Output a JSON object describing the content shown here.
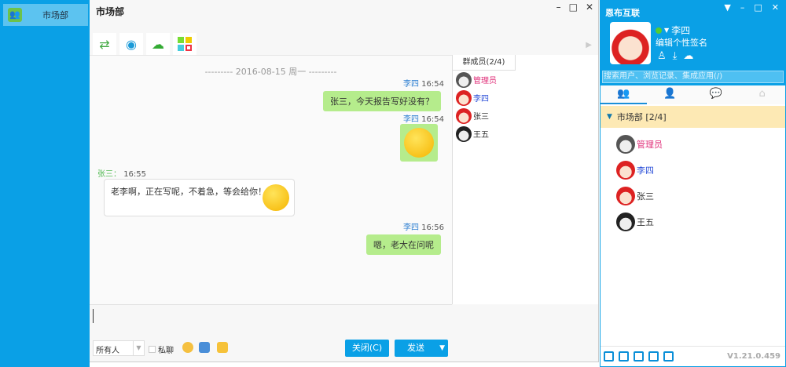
{
  "sidebar": {
    "items": [
      {
        "label": "市场部"
      }
    ]
  },
  "chat": {
    "title": "市场部",
    "window_buttons": [
      "–",
      "□",
      "✕"
    ],
    "date_divider": "--------- 2016-08-15 周一 ---------",
    "messages": [
      {
        "sender": "李四",
        "time": "16:54",
        "text": "张三，今天报告写好没有？",
        "side": "right"
      },
      {
        "sender": "李四",
        "time": "16:54",
        "text": "",
        "side": "right",
        "sticker": true
      },
      {
        "sender": "张三：",
        "time": "16:55",
        "text": "老李啊，正在写呢，不着急，等会给你！",
        "side": "left"
      },
      {
        "sender": "李四",
        "time": "16:56",
        "text": "嗯，老大在问呢",
        "side": "right"
      }
    ],
    "members_tab": "群成员(2/4)",
    "members": [
      {
        "name": "管理员",
        "color": "#e0307a"
      },
      {
        "name": "李四",
        "color": "#2b4fd8"
      },
      {
        "name": "张三",
        "color": "#333"
      },
      {
        "name": "王五",
        "color": "#333"
      }
    ],
    "recipient_select": "所有人",
    "private_label": "私聊",
    "close_label": "关闭(C)",
    "send_label": "发送"
  },
  "main": {
    "app_title": "恩布互联",
    "user_name": "李四",
    "signature": "编辑个性签名",
    "search_placeholder": "搜索用户、浏览记录、集成应用(/)",
    "group": "市场部 [2/4]",
    "members": [
      {
        "name": "管理员",
        "color": "#e0307a"
      },
      {
        "name": "李四",
        "color": "#2b4fd8"
      },
      {
        "name": "张三",
        "color": "#333"
      },
      {
        "name": "王五",
        "color": "#333"
      }
    ],
    "version": "V1.21.0.459"
  }
}
